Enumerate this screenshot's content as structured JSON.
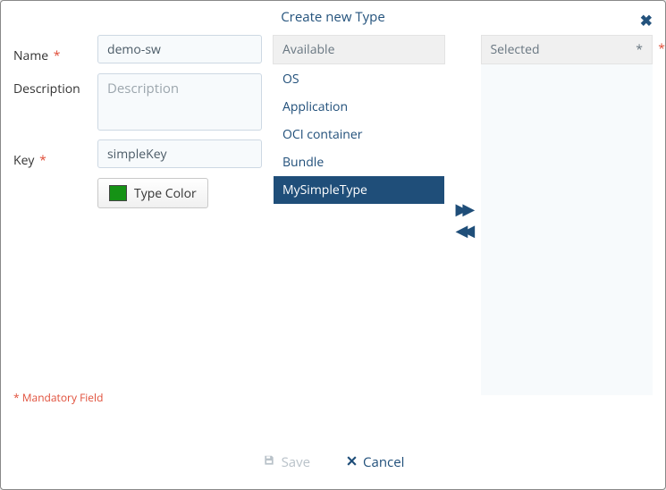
{
  "dialog": {
    "title": "Create new Type",
    "close_aria": "Close"
  },
  "form": {
    "name_label": "Name",
    "name_value": "demo-sw",
    "description_label": "Description",
    "description_placeholder": "Description",
    "description_value": "",
    "key_label": "Key",
    "key_value": "simpleKey",
    "type_color_label": "Type Color",
    "type_color_value": "#159215",
    "mandatory_text": "* Mandatory Field"
  },
  "picklist": {
    "available_header": "Available",
    "selected_header": "Selected",
    "selected_asterisk": "*",
    "available": [
      {
        "label": "OS"
      },
      {
        "label": "Application"
      },
      {
        "label": "OCI container"
      },
      {
        "label": "Bundle"
      },
      {
        "label": "MySimpleType",
        "selected": true
      }
    ],
    "selected": []
  },
  "footer": {
    "save_label": "Save",
    "cancel_label": "Cancel"
  },
  "required_marker": "*"
}
